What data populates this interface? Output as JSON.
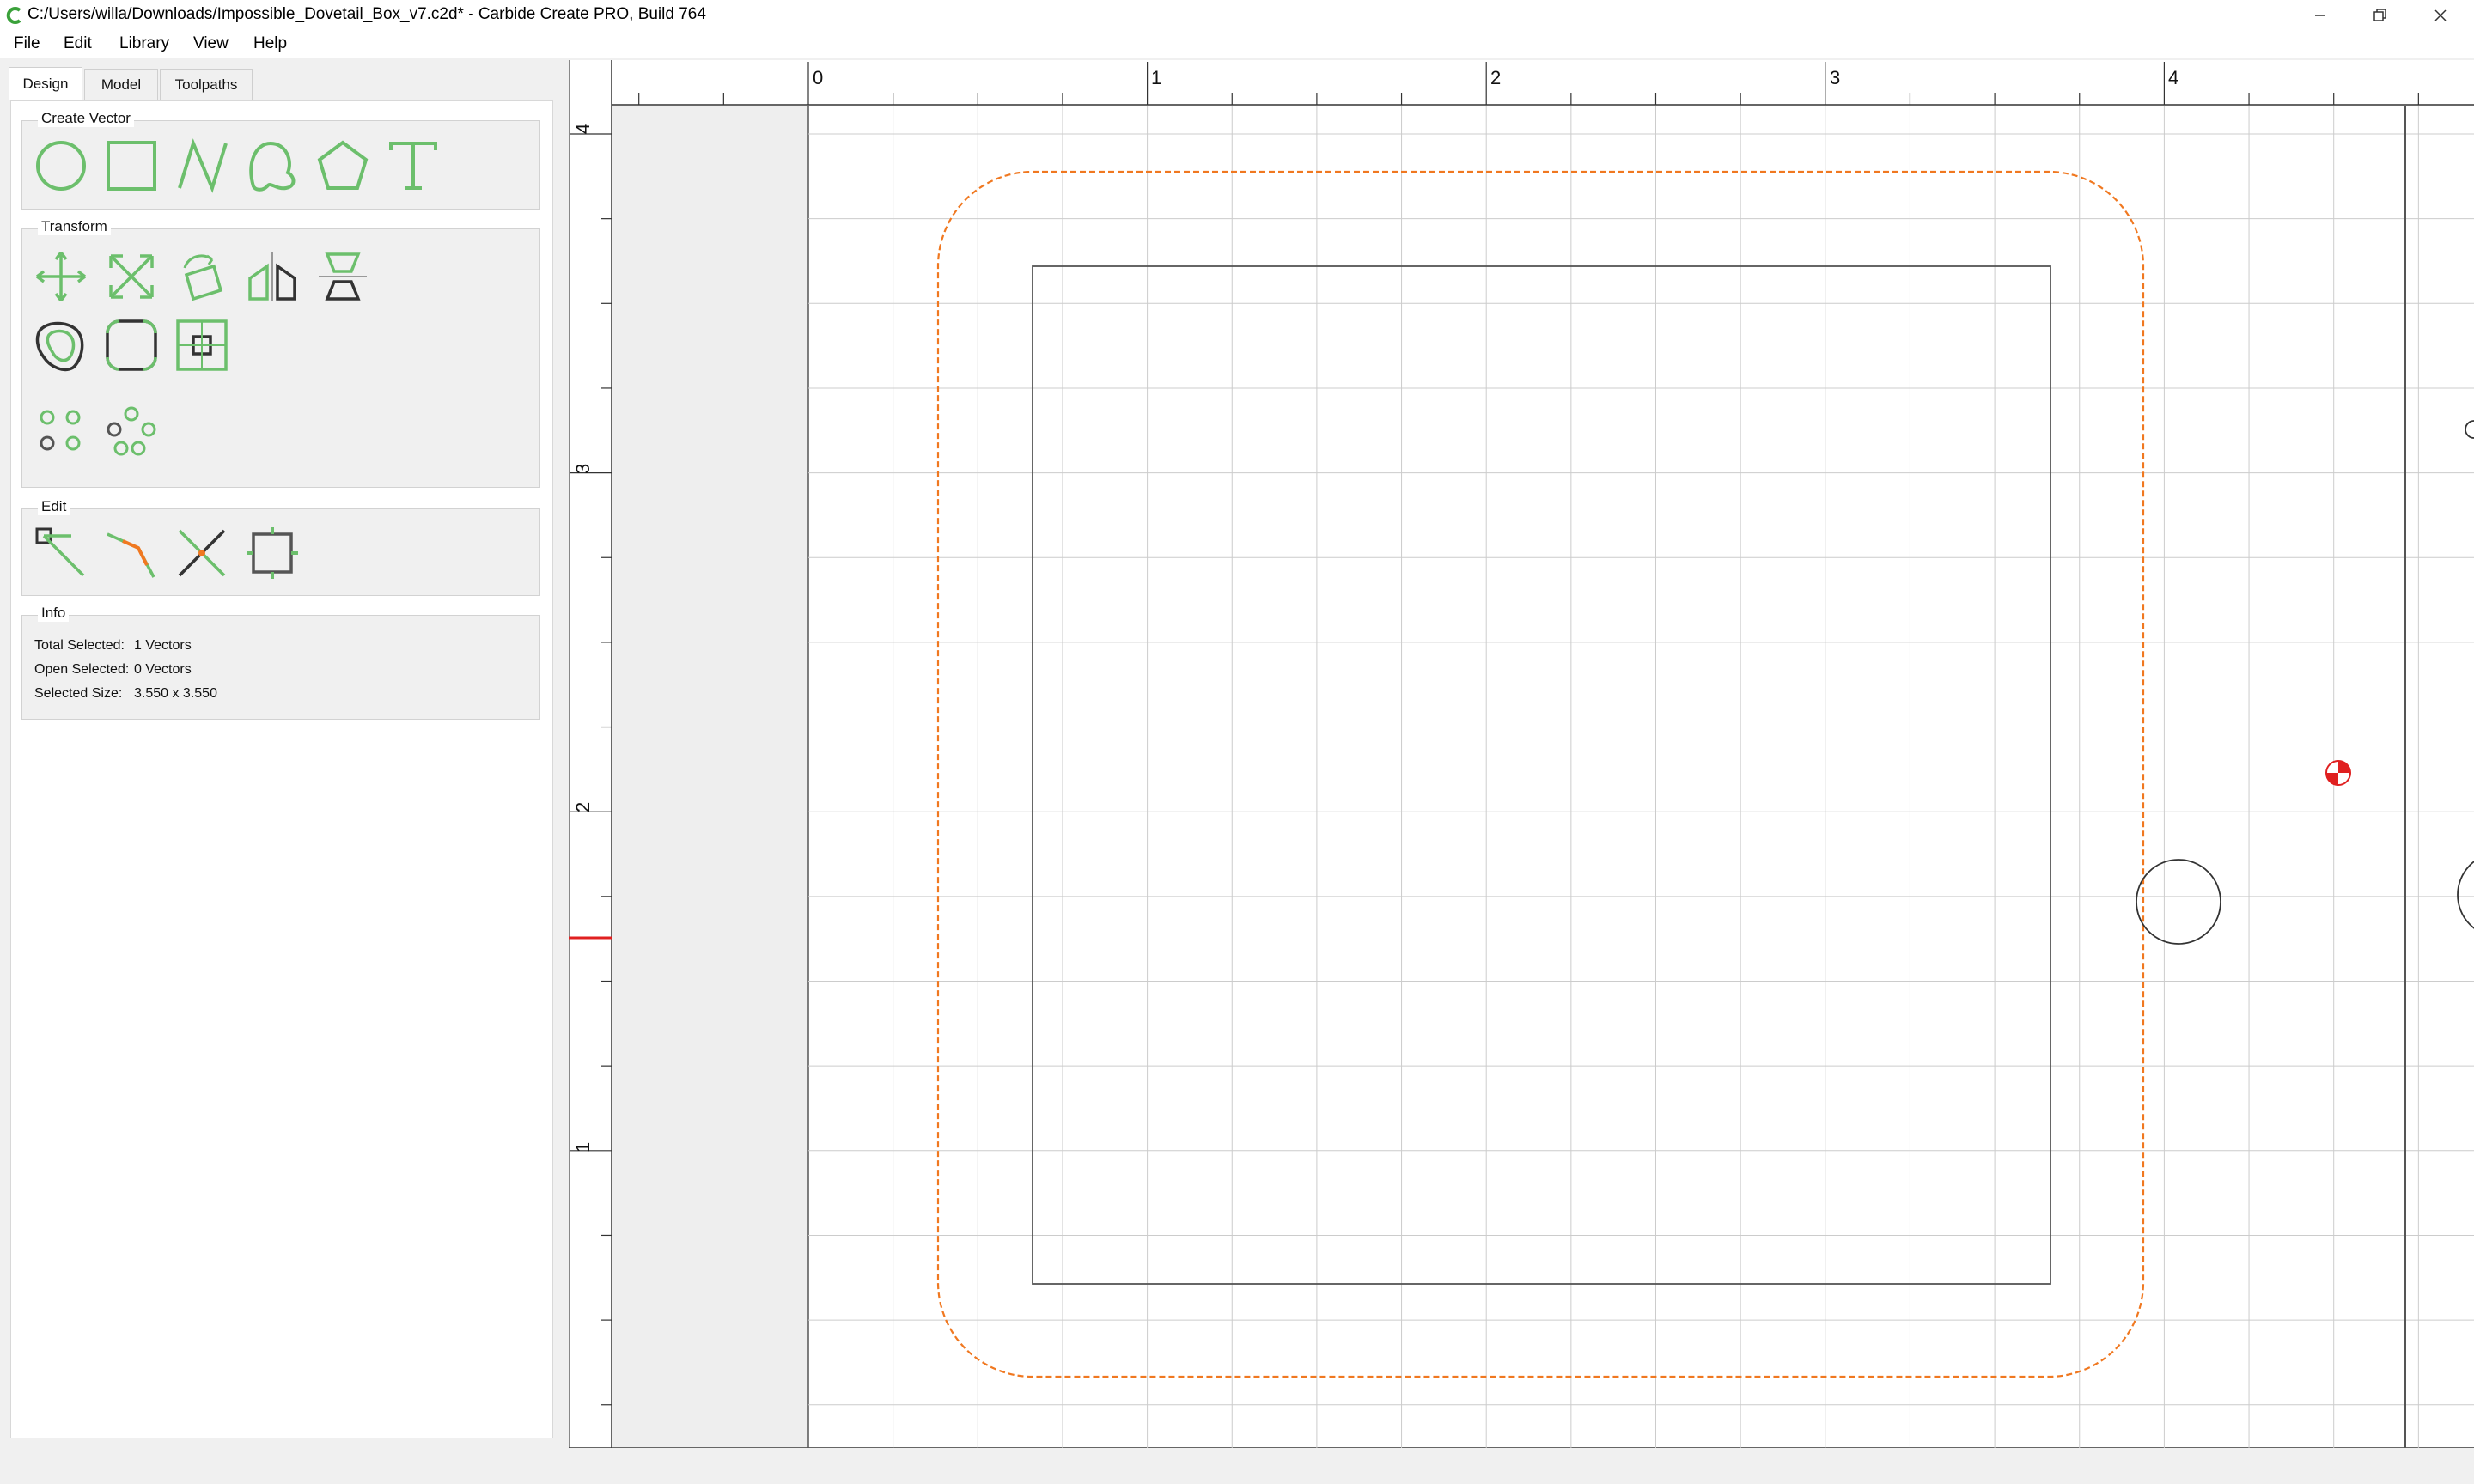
{
  "titlebar": {
    "title": "C:/Users/willa/Downloads/Impossible_Dovetail_Box_v7.c2d* - Carbide Create PRO, Build 764",
    "minimize_icon": "minimize-icon",
    "restore_icon": "restore-icon",
    "close_icon": "close-icon"
  },
  "menu": {
    "items": [
      {
        "label": "File"
      },
      {
        "label": "Edit"
      },
      {
        "label": "Library"
      },
      {
        "label": "View"
      },
      {
        "label": "Help"
      }
    ]
  },
  "tabs": [
    {
      "label": "Design",
      "active": true
    },
    {
      "label": "Model",
      "active": false
    },
    {
      "label": "Toolpaths",
      "active": false
    }
  ],
  "groups": {
    "create_vector": {
      "title": "Create Vector",
      "tools": [
        "circle-tool-icon",
        "rectangle-tool-icon",
        "polyline-tool-icon",
        "curve-tool-icon",
        "polygon-tool-icon",
        "text-tool-icon"
      ]
    },
    "transform": {
      "title": "Transform",
      "tools": [
        "move-icon",
        "scale-icon",
        "rotate-icon",
        "mirror-icon",
        "align-icon",
        "offset-icon",
        "fillet-icon",
        "boolean-icon",
        "grid-array-icon",
        "circular-array-icon"
      ]
    },
    "edit": {
      "title": "Edit",
      "tools": [
        "node-edit-icon",
        "join-icon",
        "trim-icon",
        "bounding-box-icon"
      ]
    },
    "info": {
      "title": "Info",
      "rows": [
        {
          "label": "Total Selected:",
          "value": "1 Vectors"
        },
        {
          "label": "Open Selected:",
          "value": "0 Vectors"
        },
        {
          "label": "Selected Size:",
          "value": "3.550 x 3.550"
        }
      ]
    }
  },
  "canvas": {
    "ruler_x_labels": [
      "0",
      "1",
      "2",
      "3",
      "4"
    ],
    "ruler_y_labels": [
      "4",
      "3",
      "2",
      "1"
    ],
    "colors": {
      "grid": "#cccccc",
      "vector": "#555555",
      "selected_offset": "#f07820",
      "origin_marker": "#e02020",
      "ruler_marker": "#e02020"
    }
  }
}
